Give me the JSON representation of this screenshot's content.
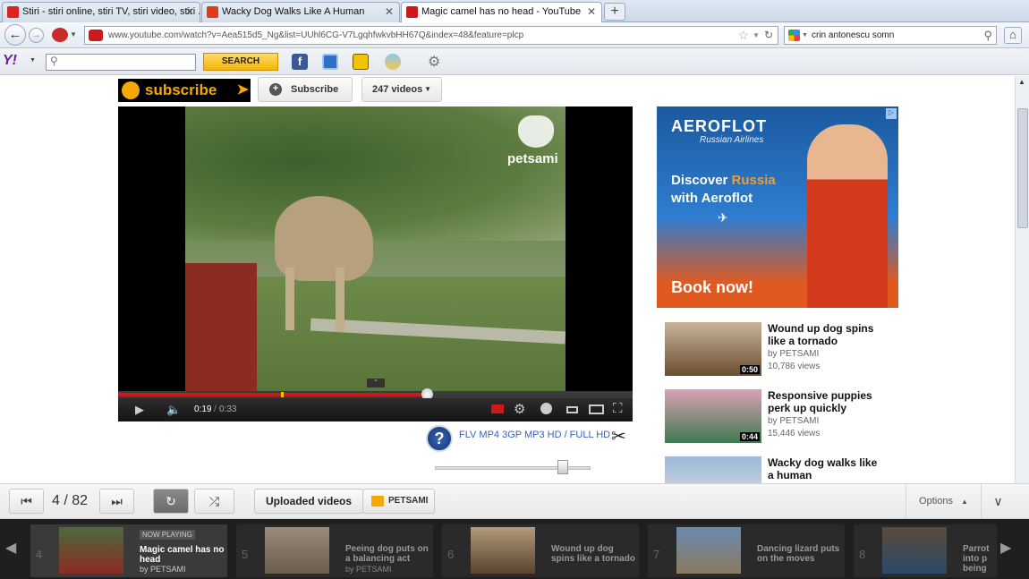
{
  "browser": {
    "tabs": [
      {
        "title": "Stiri - stiri online, stiri TV, stiri video, stiri ...",
        "active": false
      },
      {
        "title": "Wacky Dog Walks Like A Human",
        "active": false
      },
      {
        "title": "Magic camel has no head - YouTube",
        "active": true
      }
    ],
    "new_tab_label": "+",
    "url": "www.youtube.com/watch?v=Aea515d5_Ng&list=UUhl6CG-V7LgqhfwkvbHH67Q&index=48&feature=plcp",
    "search_value": "crin antonescu somn"
  },
  "yahoo_toolbar": {
    "logo": "Y!",
    "search_button": "SEARCH",
    "search_value": ""
  },
  "channel": {
    "subscribe_banner": "subscribe",
    "subscribe_button": "Subscribe",
    "videos_count": "247 videos"
  },
  "player": {
    "watermark": "petsami",
    "current_time": "0:19",
    "duration": "0:33",
    "progress": 0.6,
    "download_links": "FLV MP4 3GP MP3 HD / FULL HD"
  },
  "ad": {
    "brand": "AEROFLOT",
    "tagline": "Russian Airlines",
    "headline_1": "Discover",
    "headline_highlight": "Russia",
    "headline_2": "with Aeroflot",
    "cta": "Book now!"
  },
  "related": [
    {
      "title": "Wound up dog spins like a tornado",
      "by": "by PETSAMI",
      "views": "10,786 views",
      "duration": "0:50"
    },
    {
      "title": "Responsive puppies perk up quickly",
      "by": "by PETSAMI",
      "views": "15,446 views",
      "duration": "0:44"
    },
    {
      "title": "Wacky dog walks like a human",
      "by": "",
      "views": "",
      "duration": ""
    }
  ],
  "playlist": {
    "position": "4 / 82",
    "uploaded_label": "Uploaded videos",
    "channel_label": "PETSAMI",
    "options_label": "Options",
    "items": [
      {
        "num": "4",
        "now_playing": "NOW PLAYING",
        "title": "Magic camel has no head",
        "by": "by PETSAMI"
      },
      {
        "num": "5",
        "title": "Peeing dog puts on a balancing act",
        "by": "by PETSAMI"
      },
      {
        "num": "6",
        "title": "Wound up dog spins like a tornado",
        "by": ""
      },
      {
        "num": "7",
        "title": "Dancing lizard puts on the moves",
        "by": ""
      },
      {
        "num": "8",
        "title": "Parrot into p being",
        "by": ""
      }
    ]
  },
  "colors": {
    "youtube_red": "#cc1a1a",
    "yahoo_yellow": "#f5b400",
    "aeroflot_orange": "#e05a1f"
  }
}
